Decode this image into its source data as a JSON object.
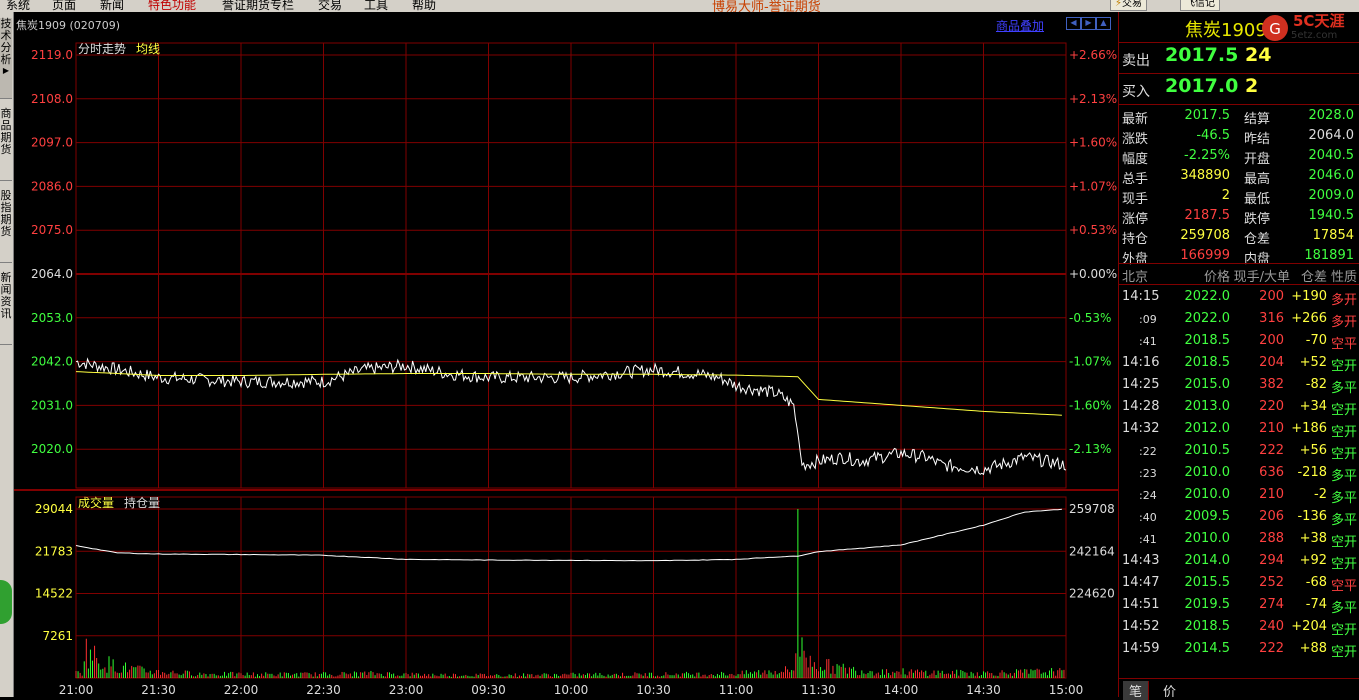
{
  "menu": {
    "items": [
      "系统",
      "页面",
      "新闻",
      "特色功能",
      "誉证期货专栏",
      "交易",
      "工具",
      "帮助"
    ],
    "app_title": "博易大师-誉证期货",
    "trade_button": "交易",
    "alert_button": "飞信记"
  },
  "left_tabs": [
    "技术分析",
    "商品期货",
    "股指期货",
    "新闻资讯"
  ],
  "chart_header": {
    "symbol_title": "焦炭1909 (020709)",
    "overlay_link": "商品叠加"
  },
  "price_panel": {
    "labels": [
      "分时走势",
      "均线"
    ],
    "y_ticks": [
      "2119.0",
      "2108.0",
      "2097.0",
      "2086.0",
      "2075.0",
      "2064.0",
      "2053.0",
      "2042.0",
      "2031.0",
      "2020.0"
    ],
    "pct_ticks": [
      "+2.66%",
      "+2.13%",
      "+1.60%",
      "+1.07%",
      "+0.53%",
      "+0.00%",
      "-0.53%",
      "-1.07%",
      "-1.60%",
      "-2.13%"
    ],
    "prev_settle": 2064.0
  },
  "volume_panel": {
    "labels": [
      "成交量",
      "持仓量"
    ],
    "y_ticks": [
      "29044",
      "21783",
      "14522",
      "7261"
    ],
    "oi_ticks": [
      "259708",
      "242164",
      "224620"
    ]
  },
  "x_ticks": [
    "21:00",
    "21:30",
    "22:00",
    "22:30",
    "23:00",
    "09:30",
    "10:00",
    "10:30",
    "11:00",
    "11:30",
    "14:00",
    "14:30",
    "15:00"
  ],
  "colors": {
    "up": "#ff4040",
    "down": "#40ff40",
    "grid": "#800000",
    "price_line": "#ffffff",
    "avg_line": "#ffff40",
    "volume_bar_up": "#ff3030",
    "volume_bar_down": "#30ff30"
  },
  "chart_data": [
    {
      "type": "line",
      "series": [
        {
          "name": "分时走势",
          "x": [
            0,
            1,
            2,
            3,
            3.5,
            4,
            4.5,
            5,
            5.5,
            6,
            6.5,
            7,
            7.5,
            7.8,
            8,
            8.5,
            8.7,
            8.75,
            8.8,
            9,
            9.3,
            9.5,
            10,
            10.3,
            10.5,
            11,
            11.2,
            11.5,
            12
          ],
          "values": [
            2042,
            2038,
            2037,
            2037,
            2040,
            2041,
            2039,
            2038,
            2038,
            2038,
            2039,
            2040,
            2039,
            2038,
            2036,
            2034,
            2031,
            2024,
            2016,
            2017,
            2018,
            2017,
            2019,
            2018,
            2016,
            2015,
            2016,
            2018,
            2016
          ]
        },
        {
          "name": "均线",
          "x": [
            0,
            1,
            2,
            3,
            4,
            5,
            6,
            7,
            8,
            8.75,
            9,
            10,
            11,
            12
          ],
          "values": [
            2039.5,
            2038.5,
            2038.5,
            2038.8,
            2039,
            2039,
            2038.8,
            2038.8,
            2038.6,
            2038.2,
            2032.5,
            2031,
            2029.5,
            2028.5
          ]
        }
      ],
      "ylim": [
        2015.5,
        2119.0
      ]
    },
    {
      "type": "bar",
      "series": [
        {
          "name": "成交量",
          "x": [
            0.1,
            0.3,
            0.5,
            0.8,
            1.0,
            1.5,
            2.0,
            3.0,
            3.6,
            4.2,
            5.0,
            6.0,
            7.0,
            8.0,
            8.7,
            8.75,
            8.78,
            8.9,
            9.2,
            9.5,
            10.0,
            10.5,
            11.0,
            11.5,
            11.9,
            12
          ],
          "values": [
            7261,
            4000,
            2800,
            1800,
            1500,
            1000,
            900,
            900,
            1100,
            800,
            700,
            800,
            900,
            1000,
            2000,
            29044,
            7261,
            4000,
            2500,
            1800,
            1500,
            1300,
            1200,
            1400,
            1600,
            1200
          ]
        },
        {
          "name": "持仓量",
          "x": [
            0,
            0.5,
            1,
            2,
            3,
            4,
            5,
            6,
            7,
            8,
            8.5,
            8.75,
            9,
            10,
            11,
            11.5,
            12
          ],
          "values": [
            244500,
            241500,
            241000,
            240800,
            240500,
            238800,
            238500,
            238400,
            238200,
            238800,
            239800,
            240200,
            242000,
            244800,
            253000,
            258500,
            259708
          ]
        }
      ]
    }
  ],
  "quote": {
    "title": "焦炭1909 (",
    "ask_label": "卖出",
    "ask_price": "2017.5",
    "ask_vol": "24",
    "bid_label": "买入",
    "bid_price": "2017.0",
    "bid_vol": "2",
    "stats": [
      {
        "l1": "最新",
        "v1": "2017.5",
        "c1": "down",
        "l2": "结算",
        "v2": "2028.0",
        "c2": "down"
      },
      {
        "l1": "涨跌",
        "v1": "-46.5",
        "c1": "down",
        "l2": "昨结",
        "v2": "2064.0",
        "c2": "neutral"
      },
      {
        "l1": "幅度",
        "v1": "-2.25%",
        "c1": "down",
        "l2": "开盘",
        "v2": "2040.5",
        "c2": "down"
      },
      {
        "l1": "总手",
        "v1": "348890",
        "c1": "yellow",
        "l2": "最高",
        "v2": "2046.0",
        "c2": "down"
      },
      {
        "l1": "现手",
        "v1": "2",
        "c1": "yellow",
        "l2": "最低",
        "v2": "2009.0",
        "c2": "down"
      },
      {
        "l1": "涨停",
        "v1": "2187.5",
        "c1": "up",
        "l2": "跌停",
        "v2": "1940.5",
        "c2": "down"
      },
      {
        "l1": "持仓",
        "v1": "259708",
        "c1": "yellow",
        "l2": "仓差",
        "v2": "17854",
        "c2": "yellow"
      },
      {
        "l1": "外盘",
        "v1": "166999",
        "c1": "up",
        "l2": "内盘",
        "v2": "181891",
        "c2": "down"
      }
    ],
    "ticks_header": [
      "北京",
      "价格",
      "现手/大单",
      "仓差",
      "性质"
    ],
    "ticks": [
      {
        "t": "14:15",
        "sub": false,
        "p": "2022.0",
        "v": "200",
        "oi": "+190",
        "ty": "多开"
      },
      {
        "t": ":09",
        "sub": true,
        "p": "2022.0",
        "v": "316",
        "oi": "+266",
        "ty": "多开"
      },
      {
        "t": ":41",
        "sub": true,
        "p": "2018.5",
        "v": "200",
        "oi": "-70",
        "ty": "空平"
      },
      {
        "t": "14:16",
        "sub": false,
        "p": "2018.5",
        "v": "204",
        "oi": "+52",
        "ty": "空开"
      },
      {
        "t": "14:25",
        "sub": false,
        "p": "2015.0",
        "v": "382",
        "oi": "-82",
        "ty": "多平"
      },
      {
        "t": "14:28",
        "sub": false,
        "p": "2013.0",
        "v": "220",
        "oi": "+34",
        "ty": "空开"
      },
      {
        "t": "14:32",
        "sub": false,
        "p": "2012.0",
        "v": "210",
        "oi": "+186",
        "ty": "空开"
      },
      {
        "t": ":22",
        "sub": true,
        "p": "2010.5",
        "v": "222",
        "oi": "+56",
        "ty": "空开"
      },
      {
        "t": ":23",
        "sub": true,
        "p": "2010.0",
        "v": "636",
        "oi": "-218",
        "ty": "多平"
      },
      {
        "t": ":24",
        "sub": true,
        "p": "2010.0",
        "v": "210",
        "oi": "-2",
        "ty": "多平"
      },
      {
        "t": ":40",
        "sub": true,
        "p": "2009.5",
        "v": "206",
        "oi": "-136",
        "ty": "多平"
      },
      {
        "t": ":41",
        "sub": true,
        "p": "2010.0",
        "v": "288",
        "oi": "+38",
        "ty": "空开"
      },
      {
        "t": "14:43",
        "sub": false,
        "p": "2014.0",
        "v": "294",
        "oi": "+92",
        "ty": "空开"
      },
      {
        "t": "14:47",
        "sub": false,
        "p": "2015.5",
        "v": "252",
        "oi": "-68",
        "ty": "空平"
      },
      {
        "t": "14:51",
        "sub": false,
        "p": "2019.5",
        "v": "274",
        "oi": "-74",
        "ty": "多平"
      },
      {
        "t": "14:52",
        "sub": false,
        "p": "2018.5",
        "v": "240",
        "oi": "+204",
        "ty": "空开"
      },
      {
        "t": "14:59",
        "sub": false,
        "p": "2014.5",
        "v": "222",
        "oi": "+88",
        "ty": "空开"
      }
    ],
    "bottom_tabs": [
      "笔",
      "价"
    ]
  }
}
